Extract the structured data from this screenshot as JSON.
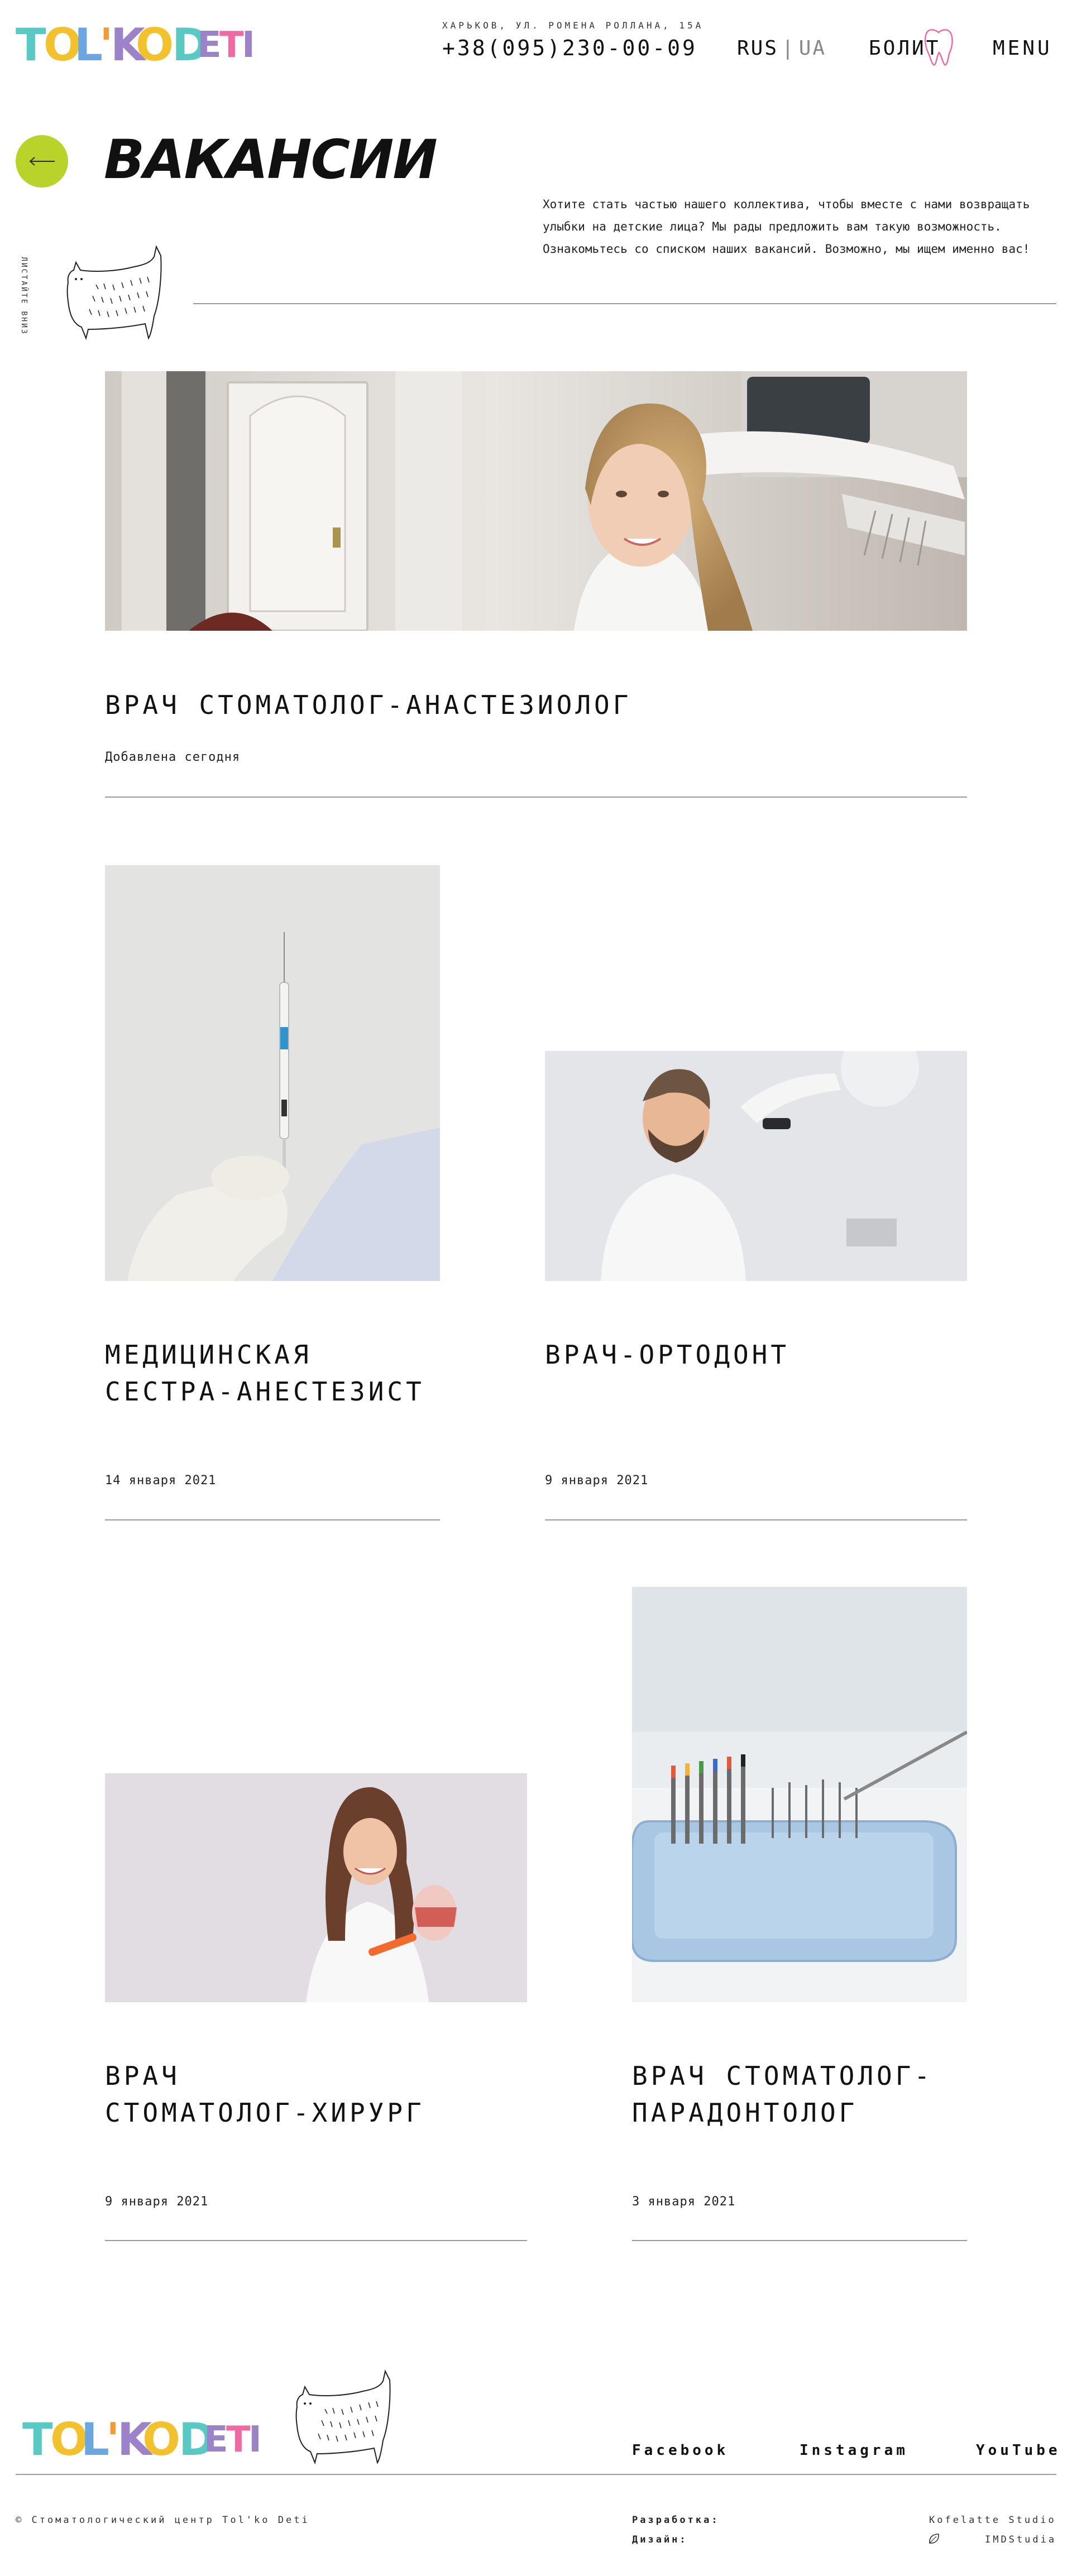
{
  "brand": {
    "logo_text": "Tol'ko Deti",
    "letters": [
      "T",
      "O",
      "L",
      "'",
      "K",
      "O",
      "D",
      "E",
      "T",
      "I"
    ],
    "colors": {
      "teal": "#5ac8c3",
      "yellow": "#f2c12e",
      "orange": "#f39a38",
      "blue": "#6aa7e0",
      "purple": "#9b82c9",
      "pink": "#ef6aa2",
      "accent_green": "#b9d32b"
    }
  },
  "header": {
    "address": "ХАРЬКОВ, УЛ. РОМЕНА РОЛЛАНА, 15А",
    "phone": "+38(095)230-00-09",
    "lang_active": "RUS",
    "lang_separator": "|",
    "lang_other": "UA",
    "bolit": "БОЛИТ",
    "menu": "MENU"
  },
  "hero": {
    "back_icon": "arrow-left-icon",
    "title": "ВАКАНСИИ",
    "intro": "Хотите стать частью нашего коллектива, чтобы вместе с нами возвращать улыбки на детские лица? Мы рады предложить вам такую возможность. Ознакомьтесь со списком наших вакансий. Возможно, мы ищем именно вас!",
    "scroll_hint": "ЛИСТАЙТЕ ВНИЗ"
  },
  "vacancies": [
    {
      "title": "ВРАЧ СТОМАТОЛОГ-АНАСТЕЗИОЛОГ",
      "date": "Добавлена сегодня"
    },
    {
      "title_line1": "МЕДИЦИНСКАЯ",
      "title_line2": "СЕСТРА-АНЕСТЕЗИСТ",
      "date": "14 января 2021"
    },
    {
      "title": "ВРАЧ-ОРТОДОНТ",
      "date": "9 января 2021"
    },
    {
      "title_line1": "ВРАЧ",
      "title_line2": "СТОМАТОЛОГ-ХИРУРГ",
      "date": "9 января 2021"
    },
    {
      "title_line1": "ВРАЧ СТОМАТОЛОГ-",
      "title_line2": "ПАРАДОНТОЛОГ",
      "date": "3 января 2021"
    }
  ],
  "footer": {
    "social": [
      "Facebook",
      "Instagram",
      "YouTube"
    ],
    "copyright": "© Стоматологический центр Tol'ko Deti",
    "dev_label": "Разработка:",
    "design_label": "Дизайн:",
    "dev_studio": "Kofelatte Studio",
    "design_studio": "IMDStudia"
  }
}
